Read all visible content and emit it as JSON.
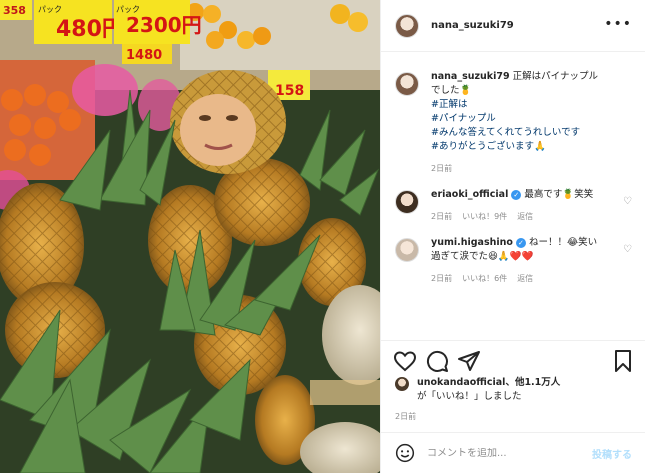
{
  "header": {
    "username": "nana_suzuki79",
    "more_label": "•••"
  },
  "photo": {
    "price_tags": [
      "358",
      "480円",
      "2300円",
      "1480",
      "158",
      "パック",
      "パック"
    ],
    "alt": "pineapple-face-photo"
  },
  "caption": {
    "username": "nana_suzuki79",
    "text": "正解はパイナップルでした🍍",
    "hashtags": [
      "#正解は",
      "#パイナップル",
      "#みんな答えてくれてうれしいです",
      "#ありがとうございます🙏"
    ],
    "time": "2日前"
  },
  "comments": [
    {
      "username": "eriaoki_official",
      "verified": true,
      "text": "最高です🍍笑笑",
      "time": "2日前",
      "likes": "いいね！9件",
      "reply": "返信"
    },
    {
      "username": "yumi.higashino",
      "verified": true,
      "text": "ねー！！😂笑い過ぎて涙でた😆🙏❤️❤️",
      "time": "2日前",
      "likes": "いいね！6件",
      "reply": "返信"
    }
  ],
  "actions": {
    "like_icon": "heart-icon",
    "comment_icon": "comment-icon",
    "share_icon": "paper-plane-icon",
    "save_icon": "bookmark-icon"
  },
  "likes": {
    "user": "unokandaofficial",
    "count_text": "、他1.1万人",
    "suffix": "が「いいね！」しました"
  },
  "posted_time": "2日前",
  "add_comment": {
    "placeholder": "コメントを追加...",
    "post_label": "投稿する"
  },
  "colors": {
    "accent_link": "#00376b",
    "verified": "#3897f0",
    "post_button_disabled": "#b2dffc",
    "muted_text": "#8e8e8e"
  }
}
